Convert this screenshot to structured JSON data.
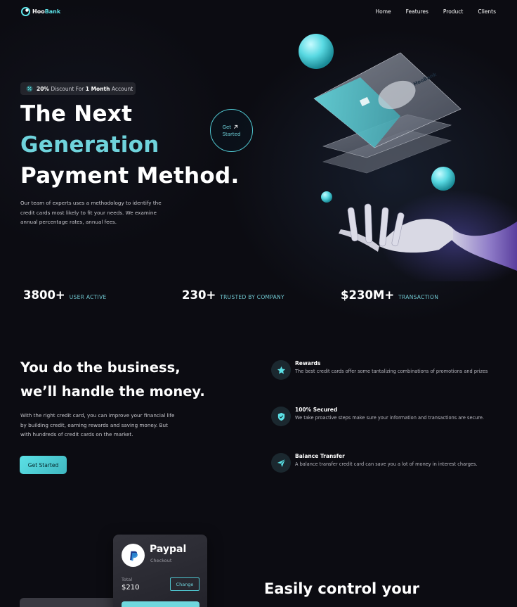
{
  "nav": {
    "brand_prefix": "Hoo",
    "brand_suffix": "Bank",
    "links": [
      "Home",
      "Features",
      "Product",
      "Clients"
    ]
  },
  "hero": {
    "badge": {
      "highlight": "20%",
      "text_1": "Discount For",
      "bold": "1 Month",
      "text_2": "Account"
    },
    "title_line_1": "The Next",
    "title_line_2": "Generation",
    "title_line_3": "Payment Method.",
    "cta_line_1": "Get",
    "cta_line_2": "Started",
    "description": "Our team of experts uses a methodology to identify the credit cards most likely to fit your needs. We examine annual percentage rates, annual fees.",
    "card_logo": "HooBank"
  },
  "stats": [
    {
      "value": "3800+",
      "label": "USER ACTIVE"
    },
    {
      "value": "230+",
      "label": "TRUSTED BY COMPANY"
    },
    {
      "value": "$230M+",
      "label": "TRANSACTION"
    }
  ],
  "business": {
    "title_line_1": "You do the business,",
    "title_line_2": "we’ll handle the money.",
    "description": "With the right credit card, you can improve your financial life by building credit, earning rewards and saving money. But with hundreds of credit cards on the market.",
    "button": "Get Started",
    "features": [
      {
        "icon": "star-icon",
        "title": "Rewards",
        "text": "The best credit cards offer some tantalizing combinations of promotions and prizes"
      },
      {
        "icon": "shield-icon",
        "title": "100% Secured",
        "text": "We take proactive steps make sure your information and transactions are secure."
      },
      {
        "icon": "send-icon",
        "title": "Balance Transfer",
        "text": "A balance transfer credit card can save you a lot of money in interest charges."
      }
    ]
  },
  "billing": {
    "card_title": "Paypal",
    "card_subtitle": "Checkout",
    "total_label": "Total",
    "total_value": "$210",
    "change_button": "Change",
    "title": "Easily control your"
  },
  "colors": {
    "accent": "#5ce1e6",
    "background": "#0c0c12"
  }
}
